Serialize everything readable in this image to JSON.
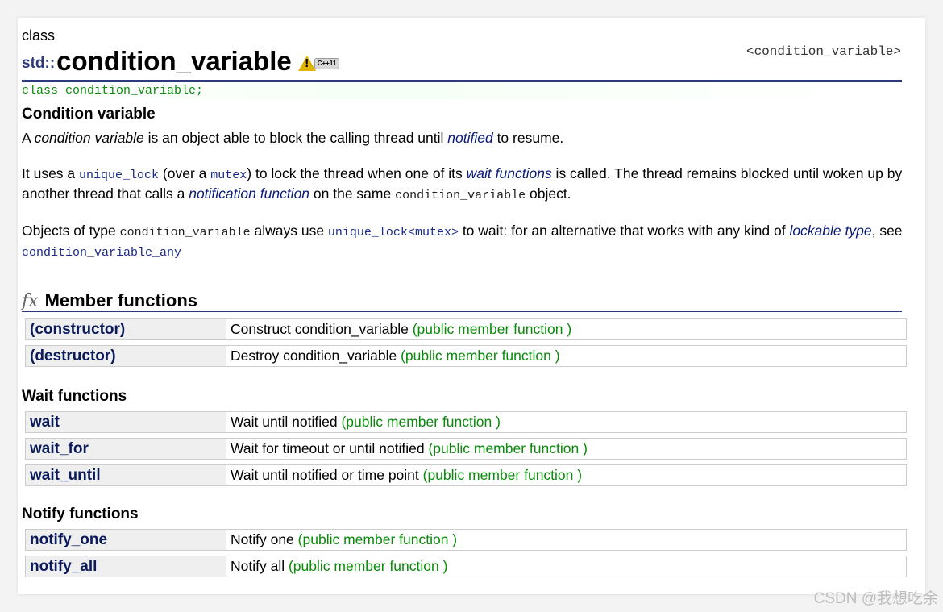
{
  "header": {
    "kind": "class",
    "namespace": "std::",
    "name": "condition_variable",
    "cpp11_badge": "C++11",
    "cpp11_warn": "!",
    "header_ref": "<condition_variable>"
  },
  "declaration": "class condition_variable;",
  "description": {
    "heading": "Condition variable",
    "p1": {
      "a": "A ",
      "b": "condition variable",
      "c": " is an object able to block the calling thread until ",
      "d": "notified",
      "e": " to resume."
    },
    "p2": {
      "a": "It uses a ",
      "b": "unique_lock",
      "c": " (over a ",
      "d": "mutex",
      "e": ") to lock the thread when one of its ",
      "f": "wait functions",
      "g": " is called. The thread remains blocked until woken up by another thread that calls a ",
      "h": "notification function",
      "i": " on the same ",
      "j": "condition_variable",
      "k": " object."
    },
    "p3": {
      "a": "Objects of type ",
      "b": "condition_variable",
      "c": " always use ",
      "d": "unique_lock<mutex>",
      "e": " to wait: for an alternative that works with any kind of ",
      "f": "lockable type",
      "g": ", see ",
      "h": "condition_variable_any"
    }
  },
  "members": {
    "section_icon": "fx",
    "section_title": "Member functions",
    "main": [
      {
        "name": "(constructor)",
        "desc": "Construct condition_variable",
        "type": "(public member function )"
      },
      {
        "name": "(destructor)",
        "desc": "Destroy condition_variable",
        "type": "(public member function )"
      }
    ],
    "wait_title": "Wait functions",
    "wait": [
      {
        "name": "wait",
        "desc": "Wait until notified",
        "type": "(public member function )"
      },
      {
        "name": "wait_for",
        "desc": "Wait for timeout or until notified",
        "type": "(public member function )"
      },
      {
        "name": "wait_until",
        "desc": "Wait until notified or time point",
        "type": "(public member function )"
      }
    ],
    "notify_title": "Notify functions",
    "notify": [
      {
        "name": "notify_one",
        "desc": "Notify one",
        "type": "(public member function )"
      },
      {
        "name": "notify_all",
        "desc": "Notify all",
        "type": "(public member function )"
      }
    ]
  },
  "watermark": "CSDN @我想吃余",
  "colors": {
    "title_rule": "#2a3a7a",
    "link": "#0a1a7a",
    "member_type": "#0a8a0a",
    "declaration": "#0a8a0a"
  }
}
